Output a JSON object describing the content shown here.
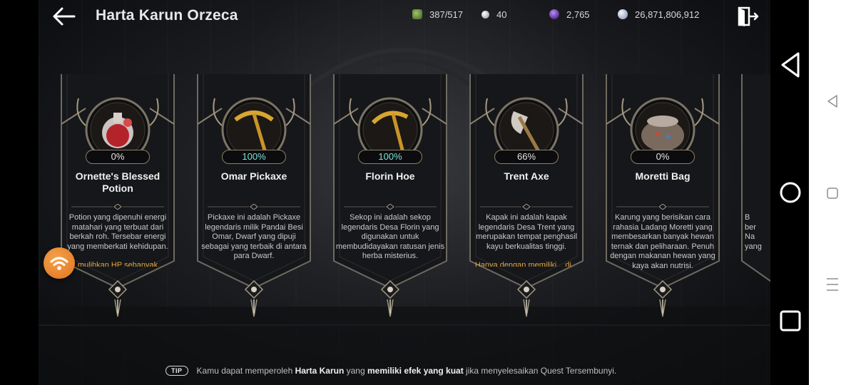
{
  "header": {
    "title": "Harta Karun Orzeca",
    "resources": [
      {
        "icon": "energy-icon",
        "value": "387/517"
      },
      {
        "icon": "pearl-icon",
        "value": "40"
      },
      {
        "icon": "crystal-icon",
        "value": "2,765"
      },
      {
        "icon": "silver-coin-icon",
        "value": "26,871,806,912"
      }
    ]
  },
  "cards": [
    {
      "name": "Ornette's Blessed Potion",
      "percent": "0%",
      "progress": 0,
      "icon": "potion-icon",
      "description": "Potion yang dipenuhi energi matahari yang terbuat dari berkah roh. Tersebar energi yang memberkati kehidupan.",
      "extra": "...mulihkan HP sebanyak..."
    },
    {
      "name": "Omar Pickaxe",
      "percent": "100%",
      "progress": 1,
      "icon": "pickaxe-icon",
      "description": "Pickaxe ini adalah Pickaxe legendaris milik Pandai Besi Omar, Dwarf yang dipuji sebagai yang terbaik di antara para Dwarf.",
      "extra": ""
    },
    {
      "name": "Florin Hoe",
      "percent": "100%",
      "progress": 1,
      "icon": "hoe-icon",
      "description": "Sekop ini adalah sekop legendaris Desa Florin yang digunakan untuk membudidayakan ratusan jenis herba misterius.",
      "extra": ""
    },
    {
      "name": "Trent Axe",
      "percent": "66%",
      "progress": 0.66,
      "icon": "axe-icon",
      "description": "Kapak ini adalah kapak legendaris Desa Trent yang merupakan tempat penghasil kayu berkualitas tinggi.",
      "extra": "Hanya dengan memiliki... di..."
    },
    {
      "name": "Moretti Bag",
      "percent": "0%",
      "progress": 0,
      "icon": "bag-icon",
      "description": "Karung yang berisikan cara rahasia Ladang Moretti yang membesarkan banyak hewan ternak dan peliharaan. Penuh dengan makanan hewan yang kaya akan nutrisi.",
      "extra": ""
    }
  ],
  "partial_card": {
    "lines": [
      "B",
      "ber",
      "Na",
      "yang"
    ]
  },
  "tip": {
    "badge": "TIP",
    "part1": "Kamu dapat memperoleh ",
    "bold1": "Harta Karun",
    "part2": " yang ",
    "bold2": "memiliki efek yang kuat",
    "part3": " jika menyelesaikan Quest Tersembunyi."
  },
  "colors": {
    "accent_full": "#7de3d6",
    "frame": "#8a7f66",
    "extra_text": "#e0a640"
  }
}
